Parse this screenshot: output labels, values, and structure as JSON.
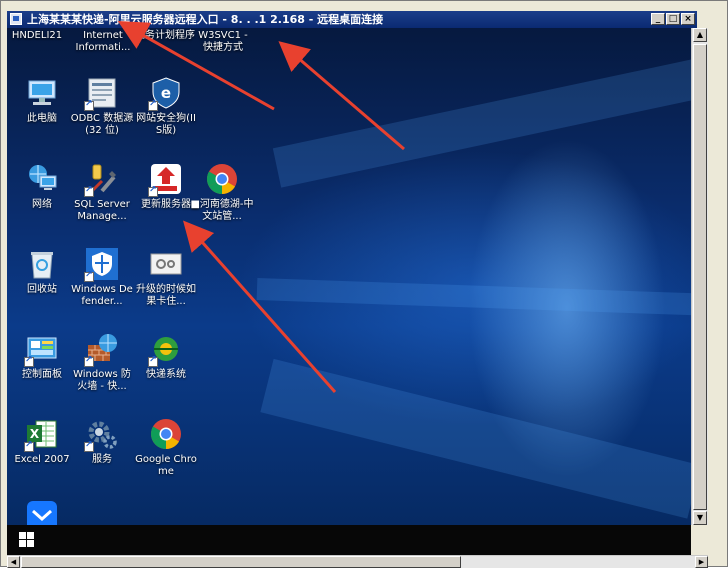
{
  "window": {
    "title": "上海某某某快递-阿里云服务器远程入口 - 8.  .  .1 2.168 - 远程桌面连接",
    "min_symbol": "_",
    "max_symbol": "□",
    "close_symbol": "×"
  },
  "top_icons": [
    {
      "label": "HNDELI21"
    },
    {
      "label": "Internet Informati..."
    },
    {
      "label": "任务计划程序"
    },
    {
      "label": "W3SVC1 - 快捷方式"
    }
  ],
  "desktop_icons": [
    {
      "label": "此电脑",
      "icon": "computer-icon"
    },
    {
      "label": "ODBC 数据源(32 位)",
      "icon": "odbc-icon"
    },
    {
      "label": "网站安全狗(IIS版)",
      "icon": "safedog-icon"
    },
    {
      "label": "网络",
      "icon": "network-icon"
    },
    {
      "label": "SQL Server Manage...",
      "icon": "sql-tools-icon"
    },
    {
      "label": "更新服务器",
      "icon": "update-server-icon"
    },
    {
      "label": "■河南德湖-中文站管...",
      "icon": "chrome-icon"
    },
    {
      "label": "回收站",
      "icon": "recycle-bin-icon"
    },
    {
      "label": "Windows Defender...",
      "icon": "defender-shield-icon"
    },
    {
      "label": "升级的时候如果卡住...",
      "icon": "settings-file-icon"
    },
    {
      "label": "控制面板",
      "icon": "control-panel-icon"
    },
    {
      "label": "Windows 防火墙 - 快...",
      "icon": "firewall-icon"
    },
    {
      "label": "快递系统",
      "icon": "express-system-icon"
    },
    {
      "label": "Excel 2007",
      "icon": "excel-icon"
    },
    {
      "label": "服务",
      "icon": "services-gear-icon"
    },
    {
      "label": "Google Chrome",
      "icon": "chrome-icon"
    },
    {
      "label": "",
      "icon": "message-icon"
    }
  ],
  "taskbar": {
    "start_icon": "windows-start-icon"
  },
  "scrollbars": {
    "up": "▲",
    "down": "▼",
    "left": "◀",
    "right": "▶"
  },
  "colors": {
    "annotation_arrow": "#e8412f",
    "titlebar": "#0b2a72",
    "taskbar": "#070707"
  }
}
